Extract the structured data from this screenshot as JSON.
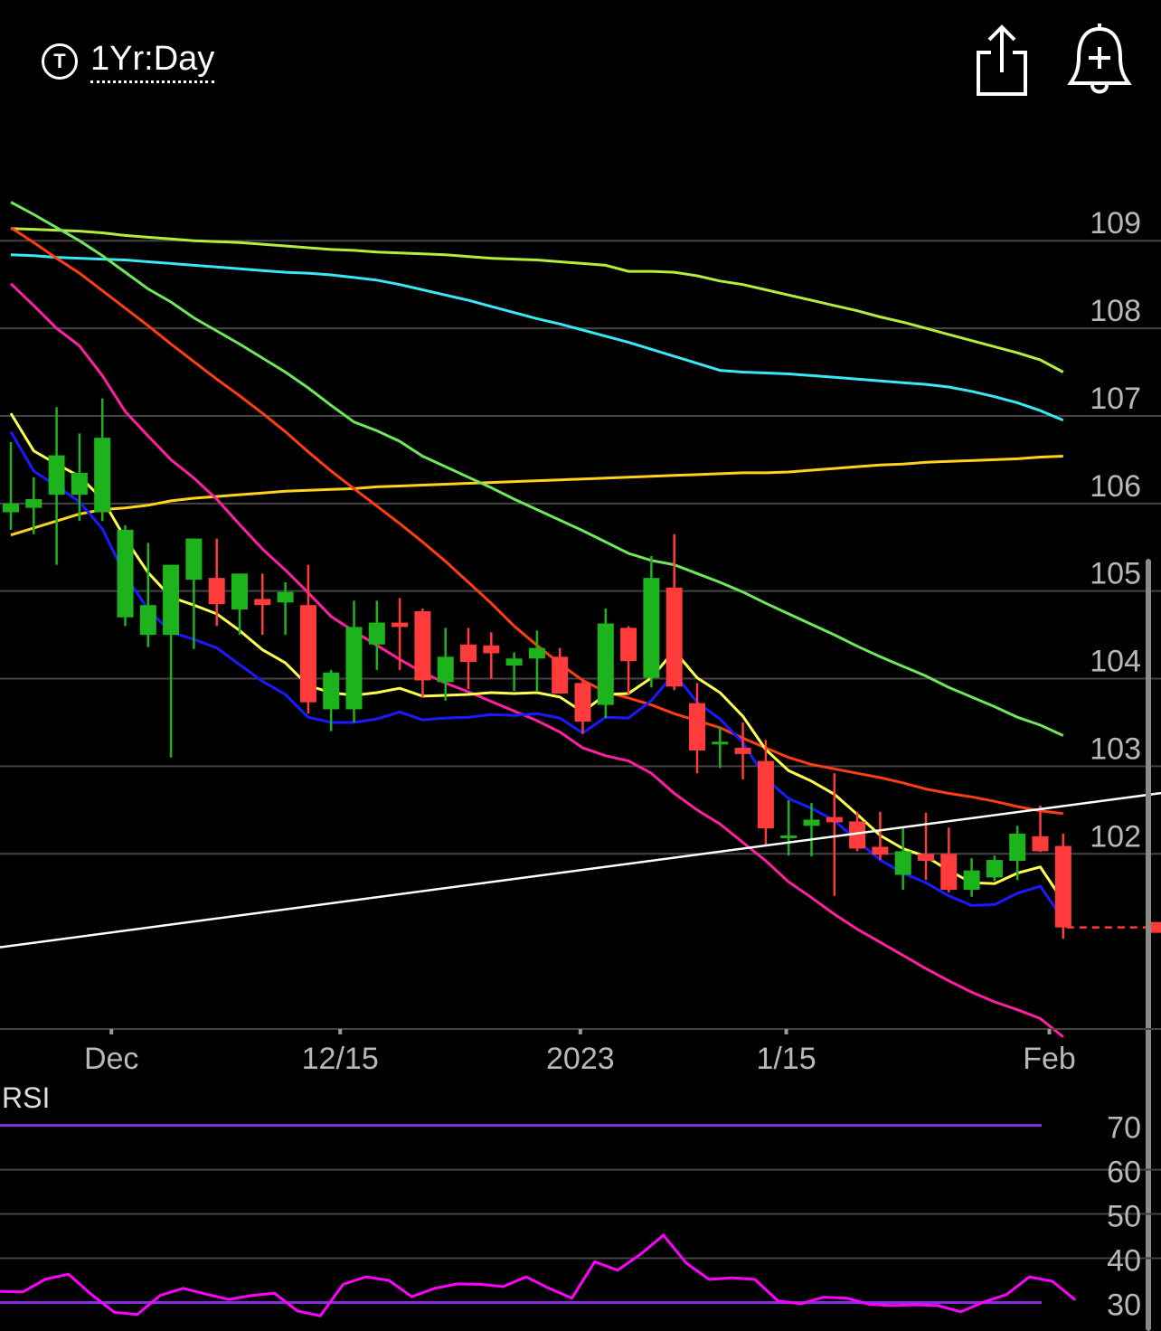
{
  "header": {
    "timeframe_icon": "T",
    "timeframe_label": "1Yr:Day",
    "share_icon": "share-icon",
    "alert_icon": "bell-plus-icon"
  },
  "colors": {
    "up": "#1db31d",
    "down": "#ff3b3b",
    "grid": "#444444",
    "axis_text": "#b8b8b8",
    "rsi_line": "#ff00ff",
    "rsi_bounds": "#8a2be2",
    "trendline": "#ffffff"
  },
  "chart_data": [
    {
      "type": "candlestick",
      "x_ticks": [
        "Dec",
        "12/15",
        "2023",
        "1/15",
        "Feb"
      ],
      "y_ticks": [
        109,
        108,
        107,
        106,
        105,
        104,
        103,
        102
      ],
      "ylim": [
        100.0,
        110.2
      ],
      "grid": true,
      "last_price": 101.16,
      "candles": [
        [
          105.9,
          106.7,
          105.7,
          106.0
        ],
        [
          105.95,
          106.3,
          105.65,
          106.05
        ],
        [
          106.1,
          107.1,
          105.3,
          106.55
        ],
        [
          106.1,
          106.8,
          105.8,
          106.35
        ],
        [
          105.9,
          107.2,
          105.8,
          106.75
        ],
        [
          104.7,
          105.75,
          104.6,
          105.7
        ],
        [
          104.5,
          105.55,
          104.36,
          104.84
        ],
        [
          104.5,
          105.3,
          103.1,
          105.3
        ],
        [
          105.13,
          105.5,
          104.34,
          105.6
        ],
        [
          105.15,
          105.6,
          104.6,
          104.85
        ],
        [
          104.79,
          105.2,
          104.5,
          105.2
        ],
        [
          104.91,
          105.2,
          104.5,
          104.84
        ],
        [
          104.87,
          105.1,
          104.5,
          104.99
        ],
        [
          104.84,
          105.3,
          103.6,
          103.73
        ],
        [
          103.65,
          104.1,
          103.4,
          104.07
        ],
        [
          103.65,
          104.89,
          103.5,
          104.59
        ],
        [
          104.39,
          104.89,
          104.1,
          104.64
        ],
        [
          104.64,
          104.92,
          104.1,
          104.59
        ],
        [
          104.77,
          104.8,
          103.78,
          103.98
        ],
        [
          103.96,
          104.58,
          103.75,
          104.25
        ],
        [
          104.39,
          104.58,
          103.88,
          104.19
        ],
        [
          104.38,
          104.53,
          104.0,
          104.29
        ],
        [
          104.15,
          104.3,
          103.86,
          104.23
        ],
        [
          104.23,
          104.55,
          103.85,
          104.35
        ],
        [
          104.25,
          104.35,
          103.85,
          103.83
        ],
        [
          103.95,
          104.0,
          103.37,
          103.51
        ],
        [
          103.7,
          104.8,
          103.55,
          104.63
        ],
        [
          104.58,
          104.6,
          103.82,
          104.2
        ],
        [
          104.01,
          105.4,
          103.9,
          105.15
        ],
        [
          105.04,
          105.65,
          103.87,
          103.91
        ],
        [
          103.72,
          103.95,
          102.92,
          103.18
        ],
        [
          103.28,
          103.45,
          102.98,
          103.28
        ],
        [
          103.21,
          103.5,
          102.85,
          103.14
        ],
        [
          103.06,
          103.3,
          102.09,
          102.29
        ],
        [
          102.19,
          102.61,
          101.98,
          102.21
        ],
        [
          102.32,
          102.58,
          101.97,
          102.39
        ],
        [
          102.42,
          102.92,
          101.52,
          102.36
        ],
        [
          102.37,
          102.48,
          102.03,
          102.06
        ],
        [
          102.08,
          102.48,
          101.93,
          101.99
        ],
        [
          101.76,
          102.29,
          101.59,
          102.03
        ],
        [
          102.0,
          102.47,
          101.7,
          101.92
        ],
        [
          102.0,
          102.3,
          101.56,
          101.59
        ],
        [
          101.59,
          101.95,
          101.51,
          101.81
        ],
        [
          101.73,
          101.98,
          101.69,
          101.93
        ],
        [
          101.92,
          102.32,
          101.7,
          102.23
        ],
        [
          102.2,
          102.55,
          102.02,
          102.03
        ],
        [
          102.09,
          102.23,
          101.03,
          101.16
        ]
      ],
      "moving_averages": [
        {
          "color": "#ffd21f",
          "values": [
            105.64,
            105.72,
            105.8,
            105.88,
            105.93,
            105.95,
            105.98,
            106.03,
            106.06,
            106.08,
            106.1,
            106.12,
            106.14,
            106.15,
            106.16,
            106.17,
            106.19,
            106.2,
            106.21,
            106.22,
            106.23,
            106.24,
            106.25,
            106.26,
            106.27,
            106.28,
            106.29,
            106.3,
            106.31,
            106.32,
            106.33,
            106.34,
            106.35,
            106.35,
            106.36,
            106.38,
            106.4,
            106.42,
            106.44,
            106.45,
            106.47,
            106.48,
            106.49,
            106.5,
            106.51,
            106.53,
            106.54
          ]
        },
        {
          "color": "#b5ee3a",
          "values": [
            109.14,
            109.13,
            109.12,
            109.11,
            109.09,
            109.06,
            109.04,
            109.02,
            109.0,
            108.99,
            108.98,
            108.96,
            108.94,
            108.92,
            108.9,
            108.89,
            108.87,
            108.86,
            108.85,
            108.84,
            108.82,
            108.8,
            108.79,
            108.78,
            108.76,
            108.74,
            108.72,
            108.65,
            108.65,
            108.64,
            108.6,
            108.54,
            108.5,
            108.44,
            108.38,
            108.32,
            108.26,
            108.2,
            108.13,
            108.07,
            108.0,
            107.93,
            107.86,
            107.79,
            107.72,
            107.64,
            107.5
          ]
        },
        {
          "color": "#38e8f5",
          "values": [
            108.84,
            108.83,
            108.81,
            108.8,
            108.79,
            108.78,
            108.76,
            108.74,
            108.72,
            108.7,
            108.68,
            108.66,
            108.64,
            108.63,
            108.61,
            108.58,
            108.55,
            108.5,
            108.44,
            108.38,
            108.32,
            108.25,
            108.18,
            108.11,
            108.05,
            107.98,
            107.91,
            107.84,
            107.76,
            107.68,
            107.6,
            107.52,
            107.5,
            107.49,
            107.48,
            107.46,
            107.44,
            107.42,
            107.4,
            107.38,
            107.36,
            107.33,
            107.28,
            107.22,
            107.15,
            107.06,
            106.95
          ]
        },
        {
          "color": "#6ee85a",
          "values": [
            109.44,
            109.3,
            109.15,
            109.0,
            108.83,
            108.64,
            108.45,
            108.3,
            108.12,
            107.97,
            107.82,
            107.66,
            107.5,
            107.32,
            107.12,
            106.93,
            106.83,
            106.71,
            106.54,
            106.42,
            106.3,
            106.18,
            106.05,
            105.93,
            105.81,
            105.69,
            105.56,
            105.43,
            105.35,
            105.3,
            105.2,
            105.1,
            104.99,
            104.86,
            104.74,
            104.62,
            104.5,
            104.37,
            104.25,
            104.14,
            104.03,
            103.9,
            103.79,
            103.68,
            103.56,
            103.47,
            103.35
          ]
        },
        {
          "color": "#ff3d14",
          "values": [
            109.15,
            108.98,
            108.8,
            108.63,
            108.43,
            108.23,
            108.03,
            107.82,
            107.62,
            107.42,
            107.23,
            107.03,
            106.82,
            106.59,
            106.37,
            106.17,
            105.97,
            105.77,
            105.56,
            105.34,
            105.1,
            104.86,
            104.6,
            104.38,
            104.17,
            103.98,
            103.85,
            103.78,
            103.7,
            103.6,
            103.52,
            103.44,
            103.32,
            103.21,
            103.1,
            103.02,
            102.97,
            102.92,
            102.87,
            102.81,
            102.74,
            102.69,
            102.65,
            102.6,
            102.54,
            102.49,
            102.46
          ]
        },
        {
          "color": "#ff1fa0",
          "values": [
            108.51,
            108.26,
            108.0,
            107.8,
            107.46,
            107.05,
            106.77,
            106.5,
            106.29,
            106.05,
            105.76,
            105.48,
            105.24,
            104.98,
            104.71,
            104.54,
            104.38,
            104.22,
            104.07,
            103.95,
            103.85,
            103.74,
            103.63,
            103.52,
            103.39,
            103.21,
            103.12,
            103.06,
            102.92,
            102.69,
            102.5,
            102.34,
            102.13,
            101.92,
            101.68,
            101.5,
            101.31,
            101.14,
            100.99,
            100.84,
            100.69,
            100.55,
            100.42,
            100.31,
            100.22,
            100.12,
            99.91
          ]
        },
        {
          "color": "#ffff4d",
          "values": [
            107.03,
            106.6,
            106.45,
            106.31,
            106.05,
            105.6,
            105.21,
            104.93,
            104.84,
            104.74,
            104.55,
            104.33,
            104.18,
            103.92,
            103.84,
            103.81,
            103.84,
            103.89,
            103.8,
            103.81,
            103.82,
            103.84,
            103.83,
            103.84,
            103.79,
            103.62,
            103.82,
            103.83,
            104.01,
            104.32,
            104.01,
            103.84,
            103.57,
            103.19,
            102.95,
            102.83,
            102.68,
            102.45,
            102.21,
            102.06,
            101.97,
            101.81,
            101.67,
            101.66,
            101.78,
            101.85,
            101.46
          ]
        },
        {
          "color": "#1a1aff",
          "values": [
            106.82,
            106.37,
            106.2,
            106.02,
            105.71,
            105.18,
            104.79,
            104.53,
            104.45,
            104.35,
            104.16,
            103.97,
            103.82,
            103.56,
            103.5,
            103.5,
            103.54,
            103.62,
            103.53,
            103.55,
            103.56,
            103.59,
            103.58,
            103.6,
            103.55,
            103.38,
            103.56,
            103.55,
            103.75,
            104.06,
            103.73,
            103.54,
            103.27,
            102.86,
            102.63,
            102.52,
            102.38,
            102.15,
            101.93,
            101.78,
            101.67,
            101.52,
            101.41,
            101.42,
            101.55,
            101.63,
            101.25
          ]
        }
      ],
      "trendline": {
        "from": [
          0,
          100.95
        ],
        "to": [
          47,
          102.58
        ]
      }
    },
    {
      "type": "line",
      "title": "RSI",
      "y_ticks": [
        70,
        60,
        50,
        40,
        30
      ],
      "ylim": [
        25,
        74
      ],
      "grid": true,
      "bounds": [
        70,
        30
      ],
      "values": [
        32.5,
        32.4,
        35.3,
        36.4,
        31.8,
        27.8,
        27.3,
        31.6,
        33.2,
        31.9,
        30.7,
        31.6,
        32.1,
        28.1,
        27.0,
        34.1,
        35.8,
        35.0,
        31.3,
        33.2,
        34.2,
        34.1,
        33.6,
        35.8,
        33.2,
        31.0,
        39.2,
        37.3,
        40.9,
        45.2,
        38.9,
        35.2,
        35.6,
        35.2,
        30.4,
        29.7,
        31.2,
        31.0,
        29.6,
        29.3,
        29.5,
        29.3,
        27.9,
        30.1,
        31.8,
        35.8,
        34.8,
        30.6
      ]
    }
  ]
}
